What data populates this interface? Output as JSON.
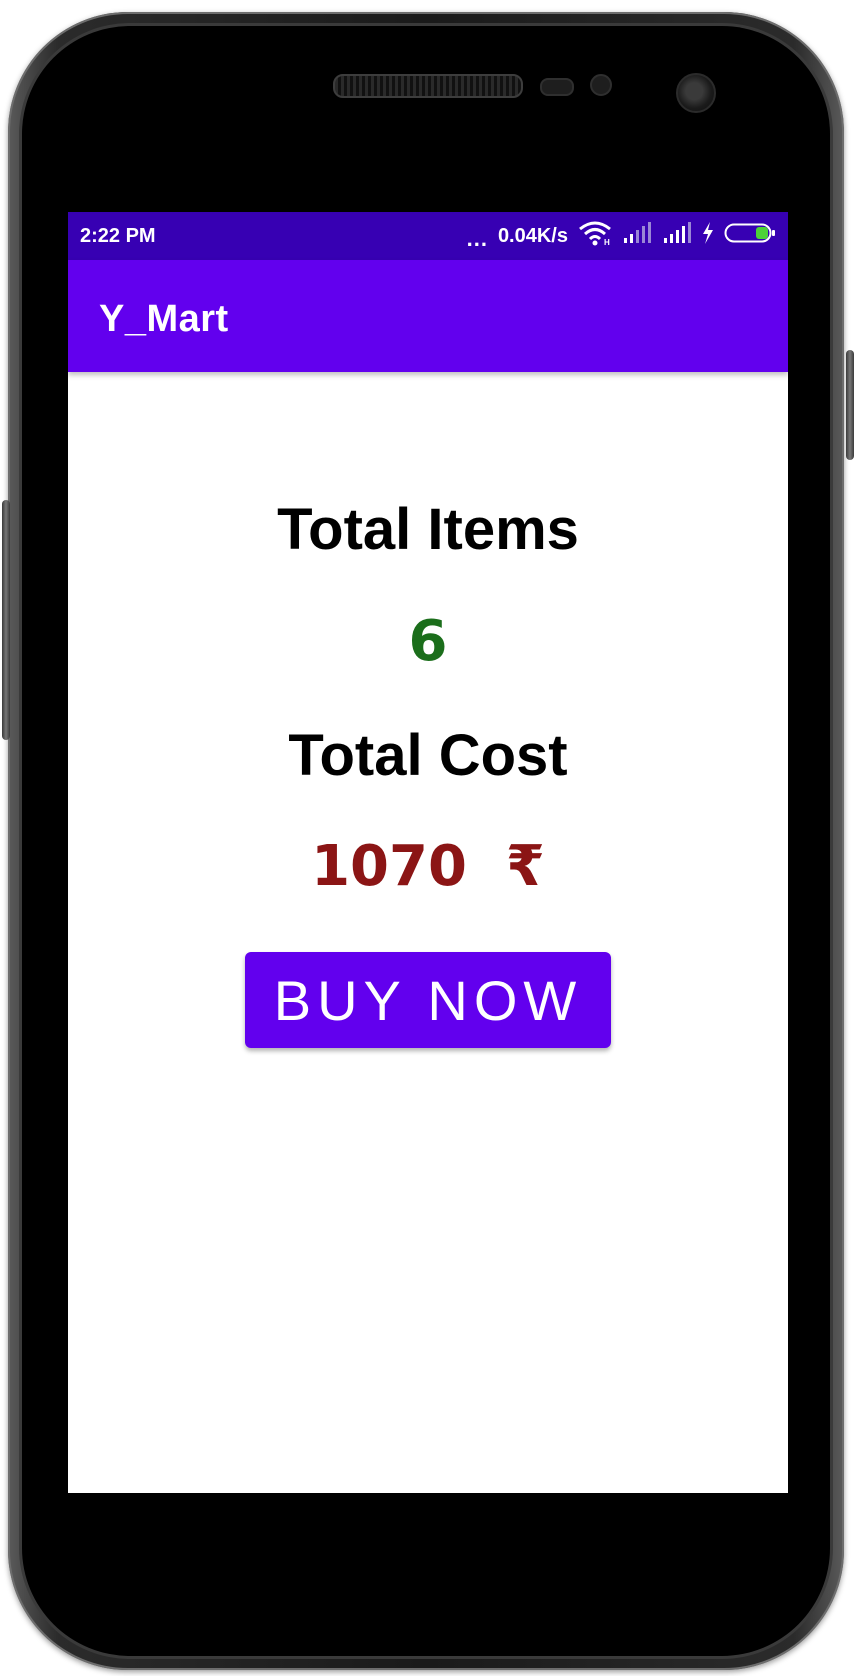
{
  "status_bar": {
    "time": "2:22 PM",
    "more_indicator": "...",
    "network_speed": "0.04K/s",
    "icons": [
      "wifi-icon",
      "signal-1-icon",
      "signal-2-icon",
      "charging-icon",
      "battery-icon"
    ],
    "battery_color": "#4cd137"
  },
  "app_bar": {
    "title": "Y_Mart",
    "color": "#6200ee"
  },
  "summary": {
    "items_label": "Total Items",
    "items_value": "6",
    "items_value_color": "#1b6e1b",
    "cost_label": "Total Cost",
    "cost_value": "1070  ₹",
    "cost_value_color": "#8b1515"
  },
  "actions": {
    "buy_label": "BUY NOW"
  },
  "colors": {
    "status_bar": "#3700b3",
    "primary": "#6200ee"
  }
}
